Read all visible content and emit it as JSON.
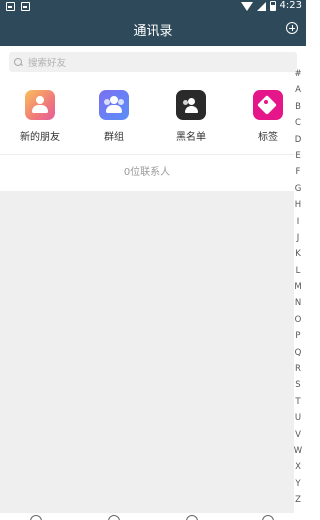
{
  "status_bar": {
    "time": "4:23"
  },
  "header": {
    "title": "通讯录"
  },
  "search": {
    "placeholder": "搜索好友"
  },
  "shortcuts": [
    {
      "label": "新的朋友",
      "icon": "new-friend-icon"
    },
    {
      "label": "群组",
      "icon": "group-icon"
    },
    {
      "label": "黑名单",
      "icon": "blacklist-icon"
    },
    {
      "label": "标签",
      "icon": "tag-icon"
    }
  ],
  "contacts": {
    "count_text": "0位联系人"
  },
  "index_letters": [
    "#",
    "A",
    "B",
    "C",
    "D",
    "E",
    "F",
    "G",
    "H",
    "I",
    "J",
    "K",
    "L",
    "M",
    "N",
    "O",
    "P",
    "Q",
    "R",
    "S",
    "T",
    "U",
    "V",
    "W",
    "X",
    "Y",
    "Z"
  ],
  "tabbar": {
    "icons": [
      "chat-icon",
      "contacts-icon",
      "discover-icon",
      "settings-icon"
    ]
  },
  "colors": {
    "header_bg": "#2e4a5a",
    "content_bg": "#efefef",
    "tag_pink": "#e4168a"
  }
}
